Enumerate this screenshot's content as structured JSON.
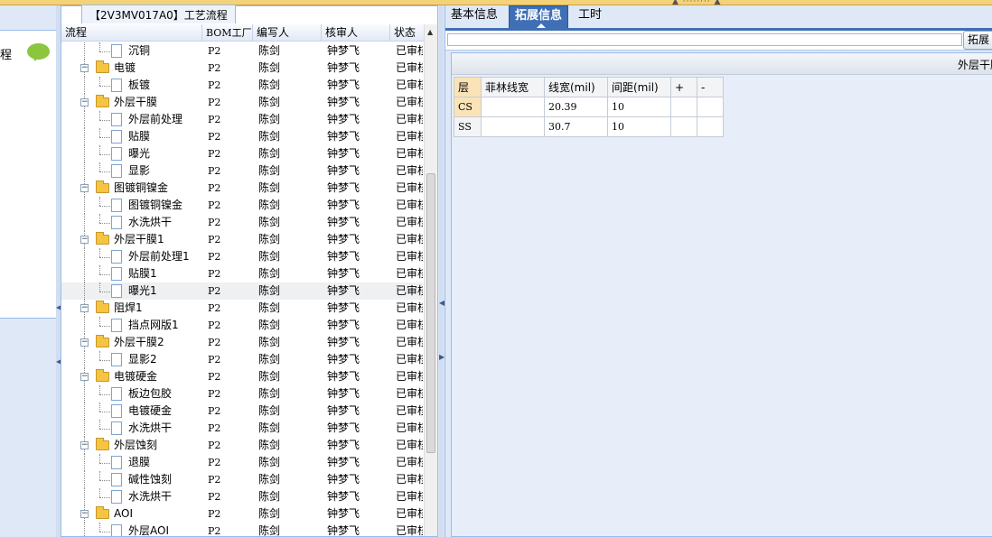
{
  "left_panel": {
    "label": "程"
  },
  "tree_panel": {
    "title": "【2V3MV017A0】工艺流程",
    "columns": [
      "流程",
      "BOM工厂",
      "编写人",
      "核审人",
      "状态"
    ],
    "rows": [
      {
        "name": "沉铜",
        "level": 2,
        "kind": "doc",
        "bom": "P2",
        "author": "陈剑",
        "reviewer": "钟梦飞",
        "status": "已审核"
      },
      {
        "name": "电镀",
        "level": 1,
        "kind": "folder",
        "bom": "P2",
        "author": "陈剑",
        "reviewer": "钟梦飞",
        "status": "已审核"
      },
      {
        "name": "板镀",
        "level": 2,
        "kind": "doc",
        "bom": "P2",
        "author": "陈剑",
        "reviewer": "钟梦飞",
        "status": "已审核"
      },
      {
        "name": "外层干膜",
        "level": 1,
        "kind": "folder",
        "bom": "P2",
        "author": "陈剑",
        "reviewer": "钟梦飞",
        "status": "已审核"
      },
      {
        "name": "外层前处理",
        "level": 2,
        "kind": "doc",
        "bom": "P2",
        "author": "陈剑",
        "reviewer": "钟梦飞",
        "status": "已审核"
      },
      {
        "name": "贴膜",
        "level": 2,
        "kind": "doc",
        "bom": "P2",
        "author": "陈剑",
        "reviewer": "钟梦飞",
        "status": "已审核"
      },
      {
        "name": "曝光",
        "level": 2,
        "kind": "doc",
        "bom": "P2",
        "author": "陈剑",
        "reviewer": "钟梦飞",
        "status": "已审核"
      },
      {
        "name": "显影",
        "level": 2,
        "kind": "doc",
        "bom": "P2",
        "author": "陈剑",
        "reviewer": "钟梦飞",
        "status": "已审核"
      },
      {
        "name": "图镀铜镍金",
        "level": 1,
        "kind": "folder",
        "bom": "P2",
        "author": "陈剑",
        "reviewer": "钟梦飞",
        "status": "已审核"
      },
      {
        "name": "图镀铜镍金",
        "level": 2,
        "kind": "doc",
        "bom": "P2",
        "author": "陈剑",
        "reviewer": "钟梦飞",
        "status": "已审核"
      },
      {
        "name": "水洗烘干",
        "level": 2,
        "kind": "doc",
        "bom": "P2",
        "author": "陈剑",
        "reviewer": "钟梦飞",
        "status": "已审核"
      },
      {
        "name": "外层干膜1",
        "level": 1,
        "kind": "folder",
        "bom": "P2",
        "author": "陈剑",
        "reviewer": "钟梦飞",
        "status": "已审核"
      },
      {
        "name": "外层前处理1",
        "level": 2,
        "kind": "doc",
        "bom": "P2",
        "author": "陈剑",
        "reviewer": "钟梦飞",
        "status": "已审核"
      },
      {
        "name": "贴膜1",
        "level": 2,
        "kind": "doc",
        "bom": "P2",
        "author": "陈剑",
        "reviewer": "钟梦飞",
        "status": "已审核"
      },
      {
        "name": "曝光1",
        "level": 2,
        "kind": "doc",
        "bom": "P2",
        "author": "陈剑",
        "reviewer": "钟梦飞",
        "status": "已审核",
        "selected": true
      },
      {
        "name": "阻焊1",
        "level": 1,
        "kind": "folder",
        "bom": "P2",
        "author": "陈剑",
        "reviewer": "钟梦飞",
        "status": "已审核"
      },
      {
        "name": "挡点网版1",
        "level": 2,
        "kind": "doc",
        "bom": "P2",
        "author": "陈剑",
        "reviewer": "钟梦飞",
        "status": "已审核"
      },
      {
        "name": "外层干膜2",
        "level": 1,
        "kind": "folder",
        "bom": "P2",
        "author": "陈剑",
        "reviewer": "钟梦飞",
        "status": "已审核"
      },
      {
        "name": "显影2",
        "level": 2,
        "kind": "doc",
        "bom": "P2",
        "author": "陈剑",
        "reviewer": "钟梦飞",
        "status": "已审核"
      },
      {
        "name": "电镀硬金",
        "level": 1,
        "kind": "folder",
        "bom": "P2",
        "author": "陈剑",
        "reviewer": "钟梦飞",
        "status": "已审核"
      },
      {
        "name": "板边包胶",
        "level": 2,
        "kind": "doc",
        "bom": "P2",
        "author": "陈剑",
        "reviewer": "钟梦飞",
        "status": "已审核"
      },
      {
        "name": "电镀硬金",
        "level": 2,
        "kind": "doc",
        "bom": "P2",
        "author": "陈剑",
        "reviewer": "钟梦飞",
        "status": "已审核"
      },
      {
        "name": "水洗烘干",
        "level": 2,
        "kind": "doc",
        "bom": "P2",
        "author": "陈剑",
        "reviewer": "钟梦飞",
        "status": "已审核"
      },
      {
        "name": "外层蚀刻",
        "level": 1,
        "kind": "folder",
        "bom": "P2",
        "author": "陈剑",
        "reviewer": "钟梦飞",
        "status": "已审核"
      },
      {
        "name": "退膜",
        "level": 2,
        "kind": "doc",
        "bom": "P2",
        "author": "陈剑",
        "reviewer": "钟梦飞",
        "status": "已审核"
      },
      {
        "name": "碱性蚀刻",
        "level": 2,
        "kind": "doc",
        "bom": "P2",
        "author": "陈剑",
        "reviewer": "钟梦飞",
        "status": "已审核"
      },
      {
        "name": "水洗烘干",
        "level": 2,
        "kind": "doc",
        "bom": "P2",
        "author": "陈剑",
        "reviewer": "钟梦飞",
        "status": "已审核"
      },
      {
        "name": "AOI",
        "level": 1,
        "kind": "folder",
        "bom": "P2",
        "author": "陈剑",
        "reviewer": "钟梦飞",
        "status": "已审核"
      },
      {
        "name": "外层AOI",
        "level": 2,
        "kind": "doc",
        "bom": "P2",
        "author": "陈剑",
        "reviewer": "钟梦飞",
        "status": "已审核"
      }
    ]
  },
  "right_panel": {
    "tabs": [
      "基本信息",
      "拓展信息",
      "工时"
    ],
    "active_tab": 1,
    "tool_button": "拓展",
    "subpanel_title": "外层干膜",
    "table": {
      "headers": [
        "层",
        "菲林线宽",
        "线宽(mil)",
        "间距(mil)",
        "+",
        "-"
      ],
      "rows": [
        {
          "layer": "CS",
          "film_width": "",
          "line_width": "20.39",
          "spacing": "10"
        },
        {
          "layer": "SS",
          "film_width": "",
          "line_width": "30.7",
          "spacing": "10"
        }
      ]
    }
  }
}
